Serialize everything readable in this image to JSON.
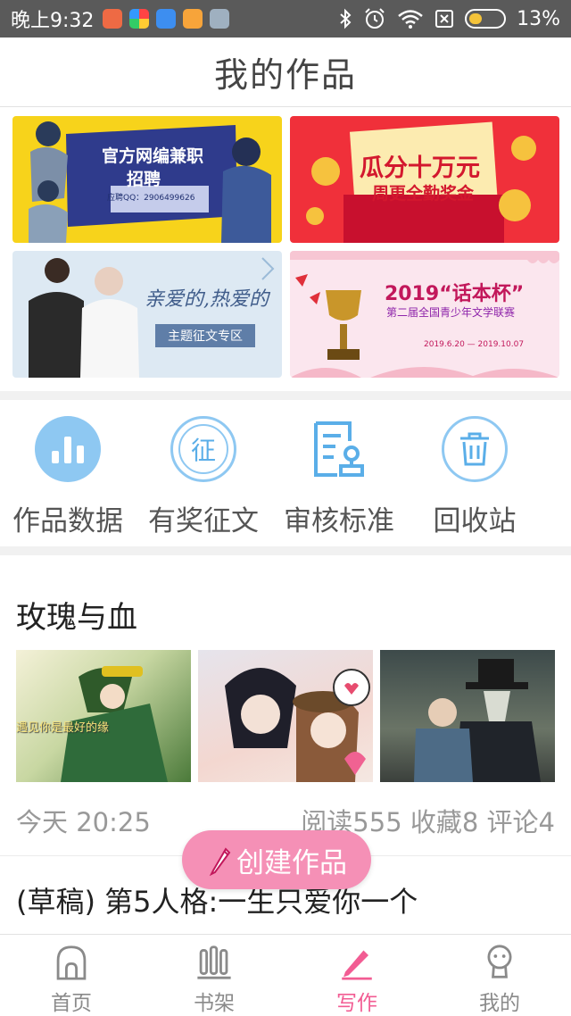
{
  "status_bar": {
    "time": "晚上9:32",
    "battery": "13%",
    "battery_level": 0.13,
    "app_icons": [
      "app-icon-red",
      "app-icon-multicolor",
      "cloud-app-icon",
      "smile-app-icon",
      "message-app-icon"
    ],
    "icons": [
      "bluetooth-icon",
      "alarm-icon",
      "wifi-icon",
      "no-sim-icon",
      "battery-icon"
    ]
  },
  "header": {
    "title": "我的作品"
  },
  "banners": [
    {
      "title": "官方网编兼职",
      "subtitle": "招聘",
      "contact": "应聘QQ：2906499626",
      "bg": "#f7d31b"
    },
    {
      "title": "瓜分十万元",
      "subtitle": "周更全勤奖金",
      "bg": "#f0303a"
    },
    {
      "title": "亲爱的,热爱的",
      "subtitle": "主题征文专区",
      "bg": "#dde9f3"
    },
    {
      "title": "2019“话本杯”",
      "subtitle": "第二届全国青少年文学联赛",
      "dates": "2019.6.20 — 2019.10.07",
      "bg": "#fbe6ee"
    }
  ],
  "quick_actions": [
    {
      "label": "作品数据",
      "icon": "bar-chart-icon"
    },
    {
      "label": "有奖征文",
      "icon": "contest-icon",
      "glyph": "征"
    },
    {
      "label": "审核标准",
      "icon": "review-standard-icon"
    },
    {
      "label": "回收站",
      "icon": "trash-icon"
    }
  ],
  "work": {
    "title": "玫瑰与血",
    "time": "今天 20:25",
    "stats": "阅读555 收藏8 评论4",
    "thumb_caption": "遇见你是最好的缘"
  },
  "draft": {
    "title": "(草稿) 第5人格:一生只爱你一个"
  },
  "create_button": {
    "label": "创建作品"
  },
  "tabs": [
    {
      "label": "首页",
      "icon": "home-icon",
      "active": false
    },
    {
      "label": "书架",
      "icon": "bookshelf-icon",
      "active": false
    },
    {
      "label": "写作",
      "icon": "pen-icon",
      "active": true
    },
    {
      "label": "我的",
      "icon": "profile-icon",
      "active": false
    }
  ],
  "colors": {
    "accent_pink": "#f25c93",
    "create_button": "#f590b6",
    "icon_blue": "#5aaee8",
    "status_bar": "#5a5a5a"
  }
}
